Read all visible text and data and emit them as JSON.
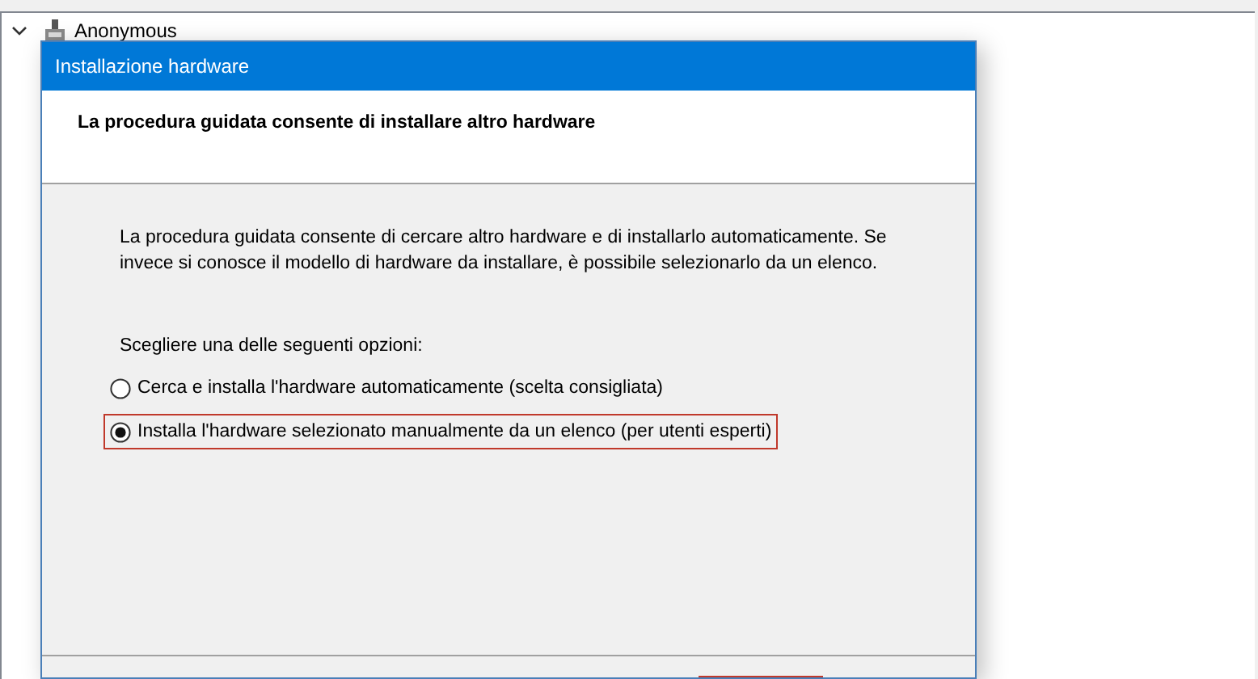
{
  "tree": {
    "items": [
      {
        "label": "Anonymous",
        "expanded": true
      }
    ]
  },
  "dialog": {
    "title": "Installazione hardware",
    "heading": "La procedura guidata consente di installare altro hardware",
    "description": "La procedura guidata consente di cercare altro hardware e di installarlo automaticamente. Se invece si conosce il modello di hardware da installare, è possibile selezionarlo da un elenco.",
    "prompt": "Scegliere una delle seguenti opzioni:",
    "options": [
      {
        "label": "Cerca e installa l'hardware automaticamente (scelta consigliata)",
        "selected": false,
        "highlighted": false
      },
      {
        "label": "Installa l'hardware selezionato manualmente da un elenco (per utenti esperti)",
        "selected": true,
        "highlighted": true
      }
    ]
  }
}
